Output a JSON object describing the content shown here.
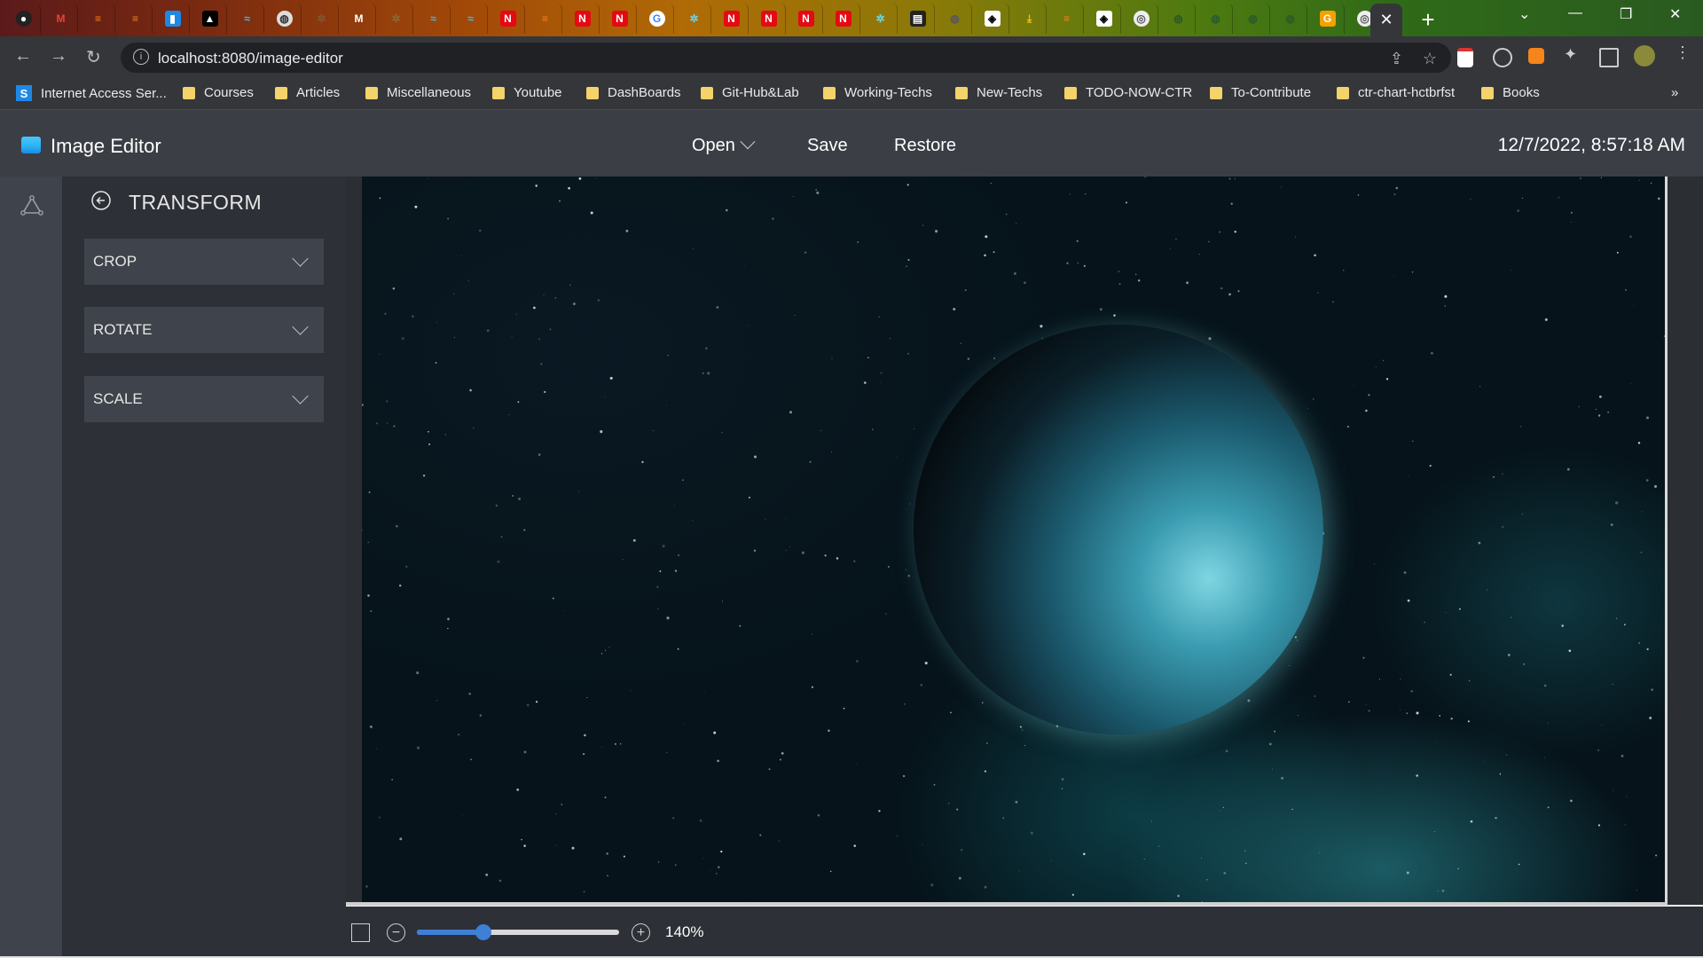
{
  "browser": {
    "url": "localhost:8080/image-editor",
    "bookmarks": [
      {
        "label": "Internet Access Ser...",
        "icon": "s-logo-icon"
      },
      {
        "label": "Courses",
        "icon": "folder-icon"
      },
      {
        "label": "Articles",
        "icon": "folder-icon"
      },
      {
        "label": "Miscellaneous",
        "icon": "folder-icon"
      },
      {
        "label": "Youtube",
        "icon": "folder-icon"
      },
      {
        "label": "DashBoards",
        "icon": "folder-icon"
      },
      {
        "label": "Git-Hub&Lab",
        "icon": "folder-icon"
      },
      {
        "label": "Working-Techs",
        "icon": "folder-icon"
      },
      {
        "label": "New-Techs",
        "icon": "folder-icon"
      },
      {
        "label": "TODO-NOW-CTR",
        "icon": "folder-icon"
      },
      {
        "label": "To-Contribute",
        "icon": "folder-icon"
      },
      {
        "label": "ctr-chart-hctbrfst",
        "icon": "folder-icon"
      },
      {
        "label": "Books",
        "icon": "folder-icon"
      }
    ],
    "more_bookmarks": "»",
    "new_tab": "+",
    "close_tab": "✕"
  },
  "app": {
    "title": "Image Editor",
    "menu": {
      "open": "Open",
      "save": "Save",
      "restore": "Restore"
    },
    "datetime": "12/7/2022, 8:57:18 AM"
  },
  "panel": {
    "title": "TRANSFORM",
    "sections": [
      {
        "label": "CROP"
      },
      {
        "label": "ROTATE"
      },
      {
        "label": "SCALE"
      }
    ]
  },
  "zoom": {
    "label": "140%",
    "slider_level": 0.33
  },
  "colors": {
    "accent": "#3f7fd6",
    "header": "#3b3e45",
    "panel": "#2d3036"
  }
}
